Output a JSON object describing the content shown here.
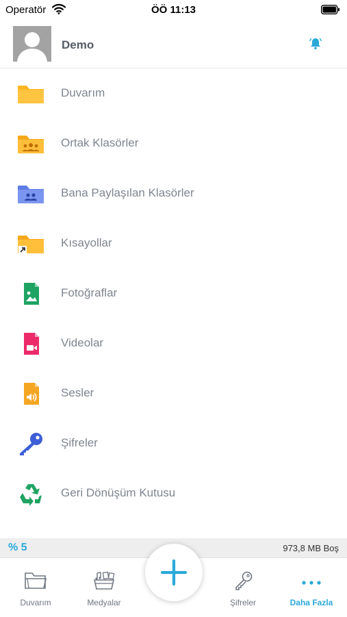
{
  "status_bar": {
    "carrier": "Operatör",
    "time": "ÖÖ 11:13"
  },
  "header": {
    "user_name": "Demo"
  },
  "menu": {
    "items": [
      {
        "label": "Duvarım",
        "icon": "folder-icon"
      },
      {
        "label": "Ortak Klasörler",
        "icon": "shared-folder-icon"
      },
      {
        "label": "Bana Paylaşılan Klasörler",
        "icon": "shared-with-me-folder-icon"
      },
      {
        "label": "Kısayollar",
        "icon": "shortcut-folder-icon"
      },
      {
        "label": "Fotoğraflar",
        "icon": "photo-file-icon"
      },
      {
        "label": "Videolar",
        "icon": "video-file-icon"
      },
      {
        "label": "Sesler",
        "icon": "audio-file-icon"
      },
      {
        "label": "Şifreler",
        "icon": "key-icon"
      },
      {
        "label": "Geri Dönüşüm Kutusu",
        "icon": "recycle-icon"
      }
    ]
  },
  "storage": {
    "percent_label": "% 5",
    "free_label": "973,8 MB Boş"
  },
  "tab_bar": {
    "tabs": [
      {
        "label": "Duvarım",
        "icon": "folder-outline-icon"
      },
      {
        "label": "Medyalar",
        "icon": "media-icon"
      },
      {
        "label": "Şifreler",
        "icon": "key-outline-icon"
      },
      {
        "label": "Daha Fazla",
        "icon": "more-dots-icon",
        "active": true
      }
    ],
    "add_button_icon": "plus-icon"
  },
  "colors": {
    "accent": "#2aa9d9",
    "folder_yellow": "#ffb620",
    "folder_blue": "#6f8df0",
    "photo_green": "#1fa362",
    "video_pink": "#ec2a6a",
    "audio_orange": "#f5a623",
    "key_blue": "#3e5fd8",
    "recycle_green": "#1fa362"
  }
}
